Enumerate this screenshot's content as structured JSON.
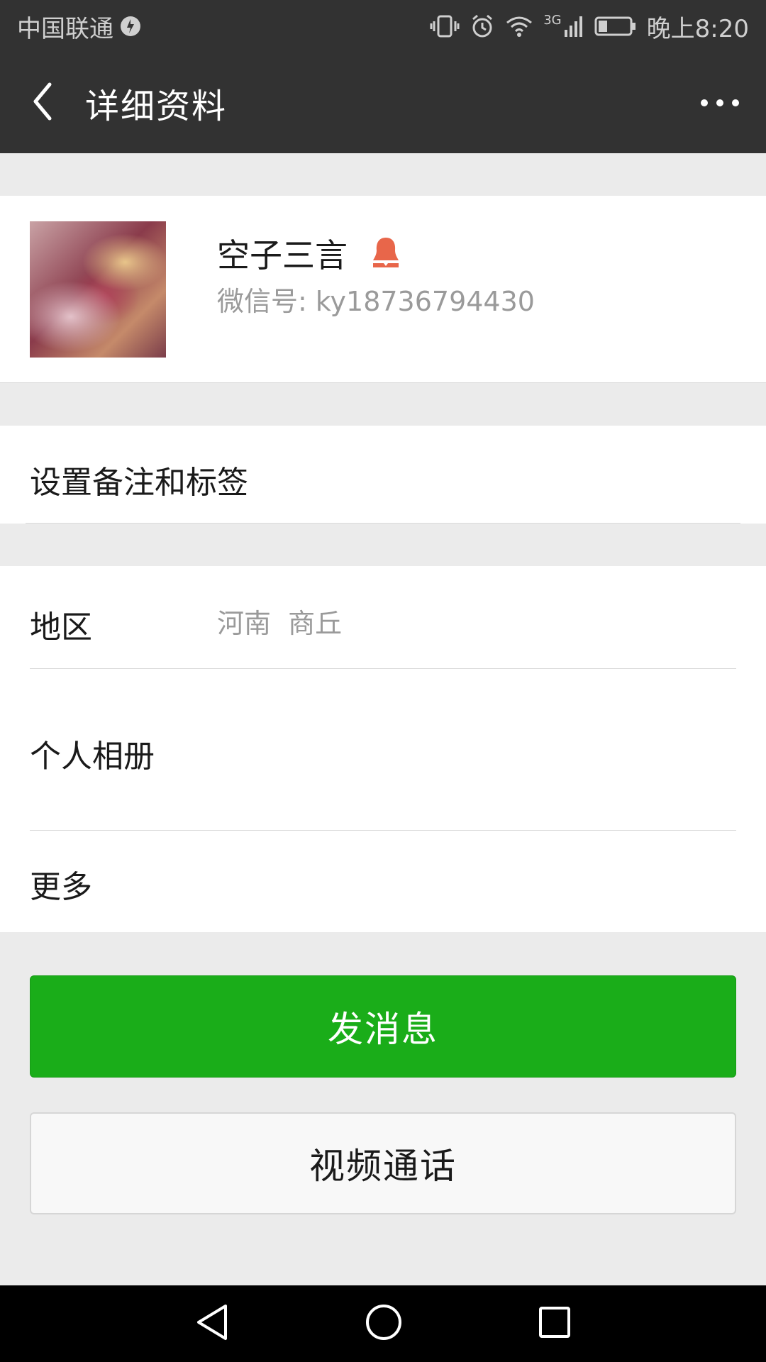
{
  "status_bar": {
    "carrier": "中国联通",
    "network": "3G",
    "time": "晚上8:20"
  },
  "header": {
    "title": "详细资料"
  },
  "profile": {
    "name": "空子三言",
    "wechat_id": "微信号: ky18736794430",
    "gender_icon_color": "#e8664a"
  },
  "remark": {
    "label": "设置备注和标签"
  },
  "info": {
    "region_label": "地区",
    "region_value": "河南  商丘",
    "album_label": "个人相册",
    "more_label": "更多"
  },
  "actions": {
    "send_message": "发消息",
    "video_call": "视频通话"
  },
  "colors": {
    "primary_green": "#1aad19",
    "header_bg": "#323232"
  }
}
